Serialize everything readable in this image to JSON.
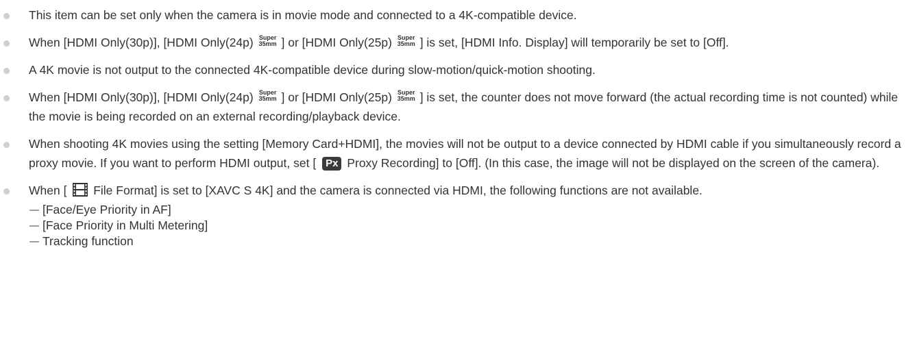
{
  "notes": [
    {
      "text": "This item can be set only when the camera is in movie mode and connected to a 4K-compatible device."
    },
    {
      "part1": "When [HDMI Only(30p)], [HDMI Only(24p)",
      "part2": "] or [HDMI Only(25p)",
      "part3": "] is set, [HDMI Info. Display] will temporarily be set to [Off]."
    },
    {
      "text": "A 4K movie is not output to the connected 4K-compatible device during slow-motion/quick-motion shooting."
    },
    {
      "part1": "When [HDMI Only(30p)], [HDMI Only(24p)",
      "part2": "] or [HDMI Only(25p)",
      "part3": "] is set, the counter does not move forward (the actual recording time is not counted) while the movie is being recorded on an external recording/playback device."
    },
    {
      "part1": "When shooting 4K movies using the setting [Memory Card+HDMI], the movies will not be output to a device connected by HDMI cable if you simultaneously record a proxy movie. If you want to perform HDMI output, set [",
      "part2": "Proxy Recording] to [Off]. (In this case, the image will not be displayed on the screen of the camera)."
    },
    {
      "part1": "When [",
      "part2": "File Format] is set to [XAVC S 4K] and the camera is connected via HDMI, the following functions are not available.",
      "subitems": [
        "[Face/Eye Priority in AF]",
        "[Face Priority in Multi Metering]",
        "Tracking function"
      ]
    }
  ],
  "icons": {
    "super35_top": "Super",
    "super35_bottom": "35mm",
    "proxy": "Px",
    "file_format_icon": "film-strip-icon"
  },
  "colors": {
    "text": "#333333",
    "bullet": "#cfcfcf",
    "dash": "#9e9e9e",
    "px_badge": "#3a3a3a"
  }
}
